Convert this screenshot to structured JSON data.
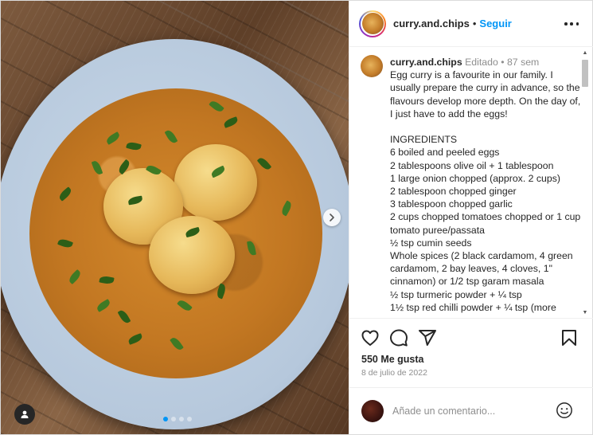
{
  "post": {
    "username": "curry.and.chips",
    "separator": "•",
    "follow_label": "Seguir",
    "more_icon": "more-horizontal-icon"
  },
  "caption": {
    "username": "curry.and.chips",
    "edited": "Editado",
    "dot": "•",
    "age": "87 sem",
    "text": "Egg curry is a favourite in our family. I usually prepare the curry in advance, so the flavours develop more depth. On the day of, I just have to add the eggs!\n\nINGREDIENTS\n6 boiled and peeled eggs\n2 tablespoons olive oil + 1 tablespoon\n1 large onion chopped (approx. 2 cups)\n2 tablespoon chopped ginger\n3 tablespoon chopped garlic\n2 cups chopped tomatoes chopped or 1 cup tomato puree/passata\n½ tsp cumin seeds\nWhole spices (2 black cardamom, 4 green cardamom, 2 bay leaves, 4 cloves, 1\" cinnamon) or 1/2 tsp garam masala\n½ tsp turmeric powder + ¼ tsp\n1½ tsp red chilli powder + ¼ tsp (more"
  },
  "actions": {
    "like_icon": "heart-icon",
    "comment_icon": "comment-icon",
    "share_icon": "share-icon",
    "save_icon": "bookmark-icon"
  },
  "likes": "550 Me gusta",
  "date": "8 de julio de 2022",
  "comment_box": {
    "placeholder": "Añade un comentario...",
    "emoji_icon": "emoji-icon"
  },
  "carousel": {
    "slides": 4,
    "active_slide": 1
  },
  "colors": {
    "accent": "#0095f6",
    "text": "#262626",
    "muted": "#8e8e8e"
  }
}
